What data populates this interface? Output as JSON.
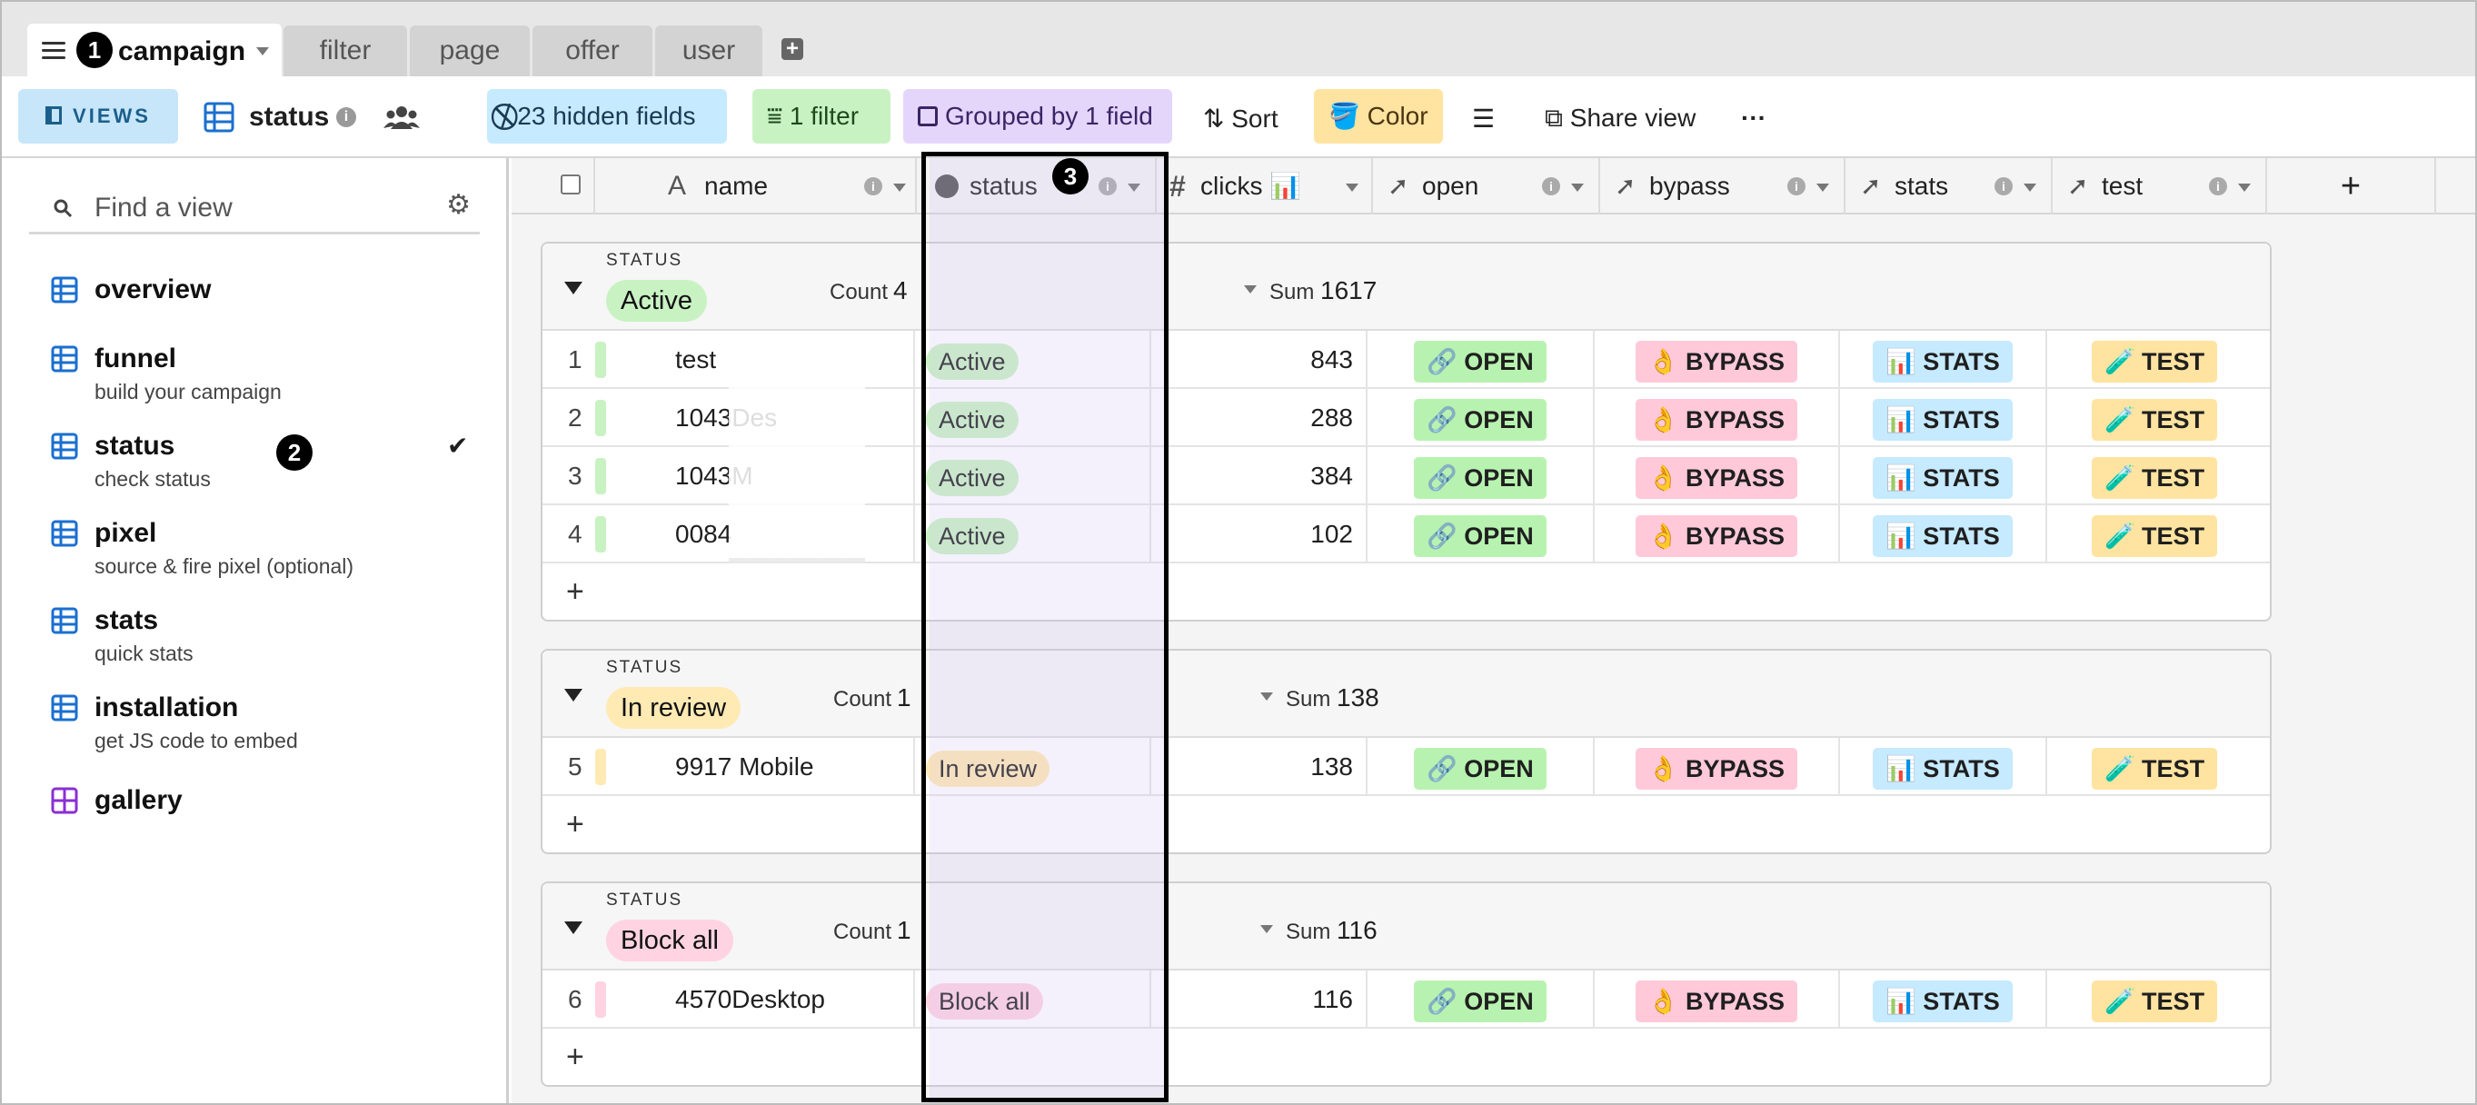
{
  "base_tabs": {
    "active": {
      "label": "campaign",
      "marker": "1"
    },
    "others": [
      "filter",
      "page",
      "offer",
      "user"
    ]
  },
  "toolbar": {
    "views_label": "VIEWS",
    "view_name": "status",
    "hidden_fields": "23 hidden fields",
    "filter": "1 filter",
    "grouped": "Grouped by 1 field",
    "sort": "Sort",
    "color": "Color",
    "share": "Share view",
    "more": "···"
  },
  "sidebar": {
    "search_placeholder": "Find a view",
    "marker": "2",
    "items": [
      {
        "title": "overview",
        "subtitle": ""
      },
      {
        "title": "funnel",
        "subtitle": "build your campaign"
      },
      {
        "title": "status",
        "subtitle": "check status"
      },
      {
        "title": "pixel",
        "subtitle": "source & fire pixel (optional)"
      },
      {
        "title": "stats",
        "subtitle": "quick stats"
      },
      {
        "title": "installation",
        "subtitle": "get JS code to embed"
      },
      {
        "title": "gallery",
        "subtitle": ""
      }
    ]
  },
  "columns": {
    "name": "name",
    "status": "status",
    "status_marker": "3",
    "clicks": "clicks 📊",
    "open": "open",
    "bypass": "bypass",
    "stats": "stats",
    "test": "test",
    "add": "+"
  },
  "groups": [
    {
      "label": "STATUS",
      "value": "Active",
      "count_label": "Count",
      "count": "4",
      "sum_label": "Sum",
      "sum": "1617",
      "rows": [
        {
          "num": "1",
          "name": "test",
          "status": "Active",
          "clicks": "843"
        },
        {
          "num": "2",
          "name": "1043Des",
          "status": "Active",
          "clicks": "288"
        },
        {
          "num": "3",
          "name": "1043M",
          "status": "Active",
          "clicks": "384"
        },
        {
          "num": "4",
          "name": "0084",
          "status": "Active",
          "clicks": "102"
        }
      ]
    },
    {
      "label": "STATUS",
      "value": "In review",
      "count_label": "Count",
      "count": "1",
      "sum_label": "Sum",
      "sum": "138",
      "rows": [
        {
          "num": "5",
          "name": "9917 Mobile",
          "status": "In review",
          "clicks": "138"
        }
      ]
    },
    {
      "label": "STATUS",
      "value": "Block all",
      "count_label": "Count",
      "count": "1",
      "sum_label": "Sum",
      "sum": "116",
      "rows": [
        {
          "num": "6",
          "name": "4570Desktop",
          "status": "Block all",
          "clicks": "116"
        }
      ]
    }
  ],
  "row_buttons": {
    "open": "🔗 OPEN",
    "bypass": "👌 BYPASS",
    "stats": "📊 STATS",
    "test": "🧪 TEST"
  },
  "add_row": "+",
  "colors": {
    "active": "#c9f2c3",
    "in_review": "#ffeab4",
    "block_all": "#ffd3e2",
    "open_btn": "#b8f2b0",
    "bypass_btn": "#ffc9da",
    "stats_btn": "#c6eaff",
    "test_btn": "#ffe3a0"
  }
}
